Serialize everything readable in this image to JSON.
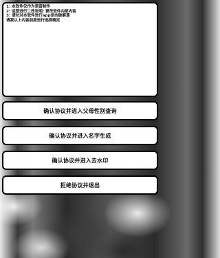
{
  "notice": {
    "lines": [
      "1: 本软件仅作为语音制作",
      "2: 运营进行二改说明: 更改软件内部内容",
      "3: 请勿对本软件进行app逆向破解源",
      "请我以上内容前提进行选择确定"
    ]
  },
  "actions": {
    "gender_query": "确认协议并进入父母性别查询",
    "name_generator": "确认协议并进入名字生成",
    "watermark_remover": "确认协议并进入去水印",
    "decline_exit": "拒绝协议并退出"
  }
}
